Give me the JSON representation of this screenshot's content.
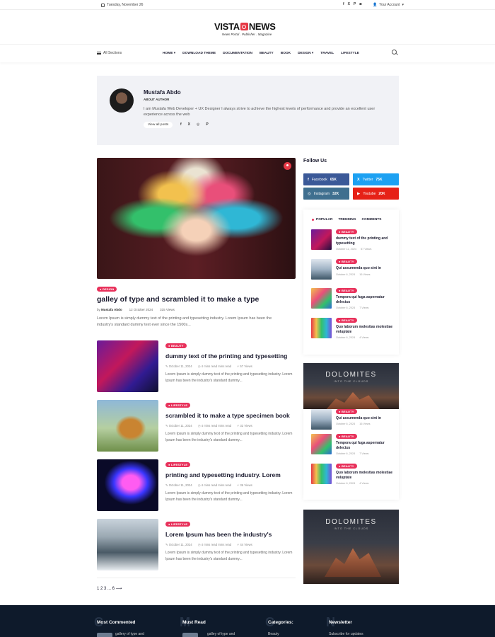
{
  "topbar": {
    "date": "Tuesday, November 26",
    "social": [
      "f",
      "X",
      "P",
      "◙"
    ],
    "account": "Your Account"
  },
  "logo": {
    "vista": "VISTA",
    "news": "NEWS",
    "tagline": "News Portal . Publisher . Magazine"
  },
  "nav": {
    "all_sections": "All Sections",
    "items": [
      "HOME",
      "DOWNLOAD THEME",
      "DOCUMENTATION",
      "BEAUTY",
      "BOOK",
      "DESIGN",
      "TRAVEL",
      "LIFESTYLE"
    ]
  },
  "author": {
    "name": "Mustafa Abdo",
    "role": "ABOUT AUTHOR",
    "bio": "I am Mustafa Web Developer + UX Designer I always strive to achieve the highest levels of performance and provide an excellent user experience across the web",
    "view_all": "View all posts",
    "social": [
      "f",
      "X",
      "◎",
      "P"
    ]
  },
  "featured": {
    "badge": "DESIGN",
    "title": "galley of type and scrambled it to make a type",
    "by": "by",
    "author": "Mustafa Abdo",
    "date": "12 October 2024",
    "views": "315 Views",
    "excerpt": "Lorem Ipsum is simply dummy text of the printing and typesetting industry. Lorem Ipsum has been the industry's standard dummy text ever since the 1500s..."
  },
  "posts": [
    {
      "badge": "BEAUTY",
      "title": "dummy text of the printing and typesetting",
      "date": "October 11, 2024",
      "read": "4 mins read mins read",
      "views": "57 Views",
      "excerpt": "Lorem Ipsum is simply dummy text of the printing and typesetting industry. Lorem Ipsum has been the industry's standard dummy..."
    },
    {
      "badge": "LIFESTYLE",
      "title": "scrambled it to make a type specimen book",
      "date": "October 11, 2024",
      "read": "4 mins read mins read",
      "views": "32 Views",
      "excerpt": "Lorem Ipsum is simply dummy text of the printing and typesetting industry. Lorem Ipsum has been the industry's standard dummy..."
    },
    {
      "badge": "LIFESTYLE",
      "title": "printing and typesetting industry. Lorem",
      "date": "October 11, 2024",
      "read": "4 mins read mins read",
      "views": "36 Views",
      "excerpt": "Lorem Ipsum is simply dummy text of the printing and typesetting industry. Lorem Ipsum has been the industry's standard dummy..."
    },
    {
      "badge": "LIFESTYLE",
      "title": "Lorem Ipsum has been the industry's",
      "date": "October 11, 2024",
      "read": "4 mins read mins read",
      "views": "44 Views",
      "excerpt": "Lorem Ipsum is simply dummy text of the printing and typesetting industry. Lorem Ipsum has been the industry's standard dummy..."
    }
  ],
  "pager": "1 2 3 ... 6 ⟶",
  "sidebar": {
    "follow_title": "Follow Us",
    "buttons": [
      {
        "icon": "f",
        "label": "Facebook",
        "count": "65K",
        "color": "#3b5998"
      },
      {
        "icon": "X",
        "label": "Twitter",
        "count": "75K",
        "color": "#1da1f2"
      },
      {
        "icon": "◎",
        "label": "Instagram",
        "count": "32K",
        "color": "#3f6f8f"
      },
      {
        "icon": "▶",
        "label": "Youtube",
        "count": "20K",
        "color": "#e62117"
      }
    ],
    "tabs": [
      "POPULAR",
      "TRENDING",
      "COMMENTS"
    ],
    "popular": [
      {
        "badge": "BEAUTY",
        "title": "dummy text of the printing and typesetting",
        "date": "October 11, 2024",
        "views": "57 Views"
      },
      {
        "badge": "BEAUTY",
        "title": "Qui assumenda quo sint in",
        "date": "October 6, 2024",
        "views": "16 Views"
      },
      {
        "badge": "BEAUTY",
        "title": "Tempora qui fuga aspernatur delectus",
        "date": "October 6, 2024",
        "views": "7 Views"
      },
      {
        "badge": "BEAUTY",
        "title": "Quo laborum molestias molestiae voluptate",
        "date": "October 6, 2024",
        "views": "4 Views"
      }
    ],
    "list2": [
      {
        "badge": "BEAUTY",
        "title": "Qui assumenda quo sint in",
        "date": "October 6, 2024",
        "views": "16 Views"
      },
      {
        "badge": "BEAUTY",
        "title": "Tempora qui fuga aspernatur delectus",
        "date": "October 6, 2024",
        "views": "7 Views"
      },
      {
        "badge": "BEAUTY",
        "title": "Quo laborum molestias molestiae voluptate",
        "date": "October 6, 2024",
        "views": "4 Views"
      }
    ],
    "ad_title": "DOLOMITES",
    "ad_sub": "INTO THE CLOUDS"
  },
  "footer": {
    "cols": [
      {
        "letter": "C",
        "title": "Most Commented",
        "sub": "gallery of type and"
      },
      {
        "letter": "M",
        "title": "Must Read",
        "sub": "galley of type and"
      },
      {
        "letter": "C",
        "title": "Categories:",
        "sub": "Beauty"
      },
      {
        "letter": "N",
        "title": "Newsletter",
        "sub": "Subscribe for updates"
      }
    ]
  }
}
